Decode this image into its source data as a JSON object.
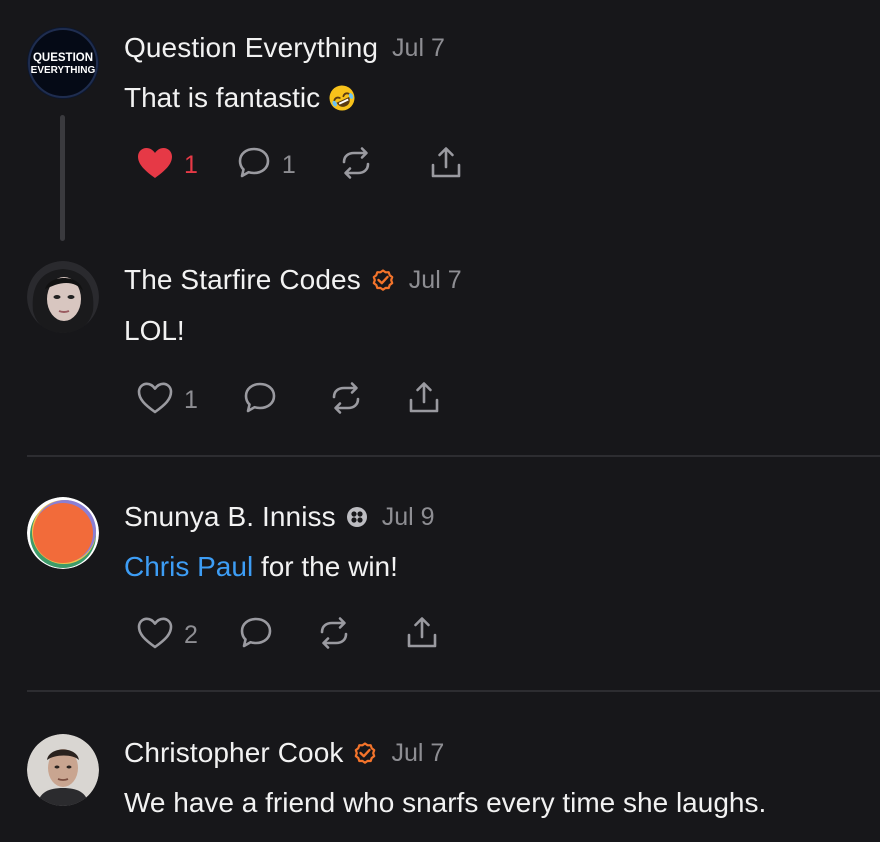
{
  "colors": {
    "background": "#17171a",
    "accent_link": "#3d9df5",
    "like_active": "#e63946",
    "verified_badge": "#f4742b",
    "muted_text": "#8e8e93"
  },
  "comments": [
    {
      "author": "Question Everything",
      "avatar_text_line1": "QUESTION",
      "avatar_text_line2": "EVERYTHING",
      "date": "Jul 7",
      "text": "That is fantastic",
      "emoji": "rolling-on-floor-laughing",
      "likes": "1",
      "liked": true,
      "replies": "1",
      "icons": [
        "heart-filled-icon",
        "comment-bubble-icon",
        "restack-icon",
        "share-icon"
      ]
    },
    {
      "author": "The Starfire Codes",
      "badge": "verified-check-icon",
      "date": "Jul 7",
      "text": "LOL!",
      "likes": "1",
      "liked": false,
      "icons": [
        "heart-outline-icon",
        "comment-bubble-icon",
        "restack-icon",
        "share-icon"
      ]
    },
    {
      "author": "Snunya B. Inniss",
      "badge": "founding-member-icon",
      "date": "Jul 9",
      "mention": "Chris Paul",
      "text": " for the win!",
      "likes": "2",
      "liked": false,
      "icons": [
        "heart-outline-icon",
        "comment-bubble-icon",
        "restack-icon",
        "share-icon"
      ]
    },
    {
      "author": "Christopher Cook",
      "badge": "verified-check-icon",
      "date": "Jul 7",
      "text": "We have a friend who snarfs every time she laughs."
    }
  ]
}
